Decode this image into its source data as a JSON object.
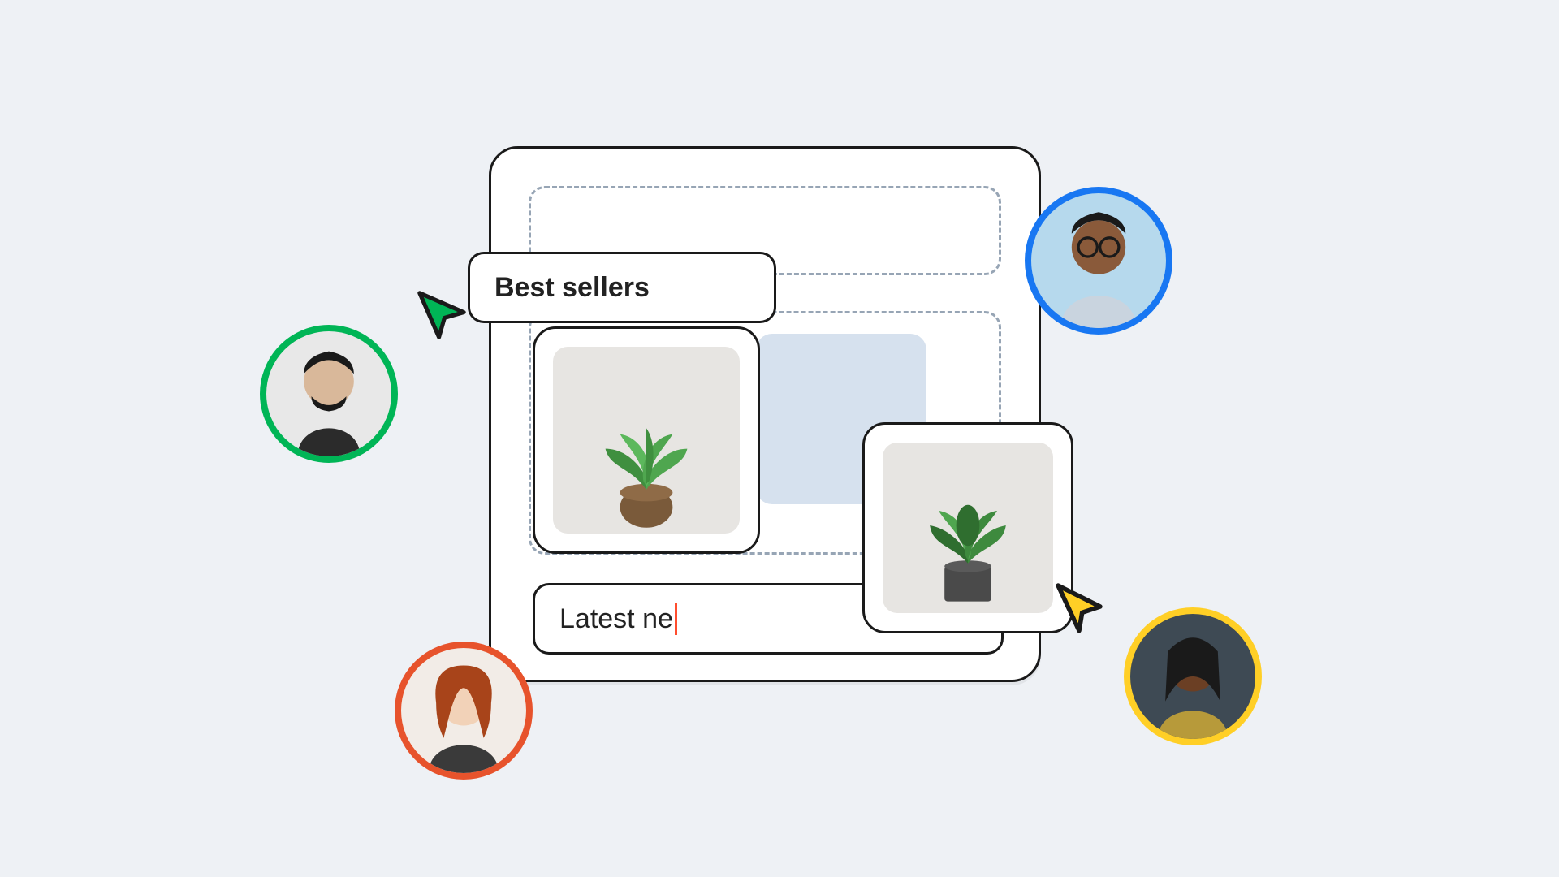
{
  "canvas": {
    "section_title": "Best sellers",
    "typing_text": "Latest ne"
  },
  "collaborators": {
    "green": {
      "cursor_color": "#00b556"
    },
    "blue": {
      "cursor_color": "#1877f2"
    },
    "orange": {
      "cursor_color": "#e7532c"
    },
    "yellow": {
      "cursor_color": "#ffcf26"
    }
  },
  "products": [
    {
      "name": "plant-brown-pot"
    },
    {
      "name": "plant-gray-pot"
    }
  ]
}
